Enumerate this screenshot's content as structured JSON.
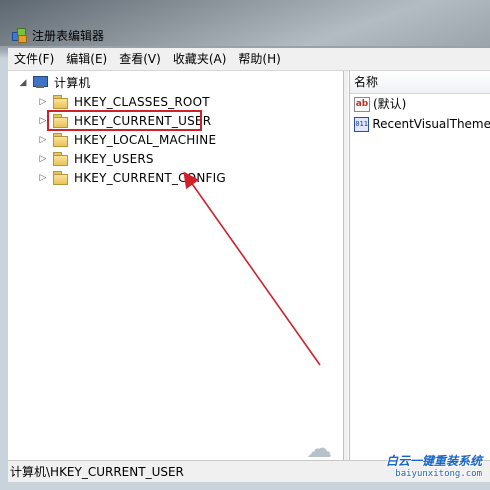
{
  "window": {
    "title": "注册表编辑器"
  },
  "menu": [
    {
      "label": "文件(F)"
    },
    {
      "label": "编辑(E)"
    },
    {
      "label": "查看(V)"
    },
    {
      "label": "收藏夹(A)"
    },
    {
      "label": "帮助(H)"
    }
  ],
  "tree": {
    "root": {
      "label": "计算机",
      "icon": "computer-icon"
    },
    "keys": [
      {
        "label": "HKEY_CLASSES_ROOT",
        "icon": "folder-icon"
      },
      {
        "label": "HKEY_CURRENT_USER",
        "icon": "folder-icon",
        "highlighted": true
      },
      {
        "label": "HKEY_LOCAL_MACHINE",
        "icon": "folder-icon"
      },
      {
        "label": "HKEY_USERS",
        "icon": "folder-icon"
      },
      {
        "label": "HKEY_CURRENT_CONFIG",
        "icon": "folder-icon"
      }
    ]
  },
  "values_pane": {
    "header": "名称",
    "rows": [
      {
        "name": "(默认)",
        "icon": "string-value-icon",
        "icon_text": "ab"
      },
      {
        "name": "RecentVisualTheme",
        "icon": "binary-value-icon",
        "icon_text": "011"
      }
    ]
  },
  "status": {
    "path": "计算机\\HKEY_CURRENT_USER"
  },
  "watermark": {
    "title": "白云一键重装系统",
    "url": "baiyunxitong.com"
  },
  "colors": {
    "annotation_red": "#d0202a",
    "watermark_blue": "#1a66c8"
  }
}
